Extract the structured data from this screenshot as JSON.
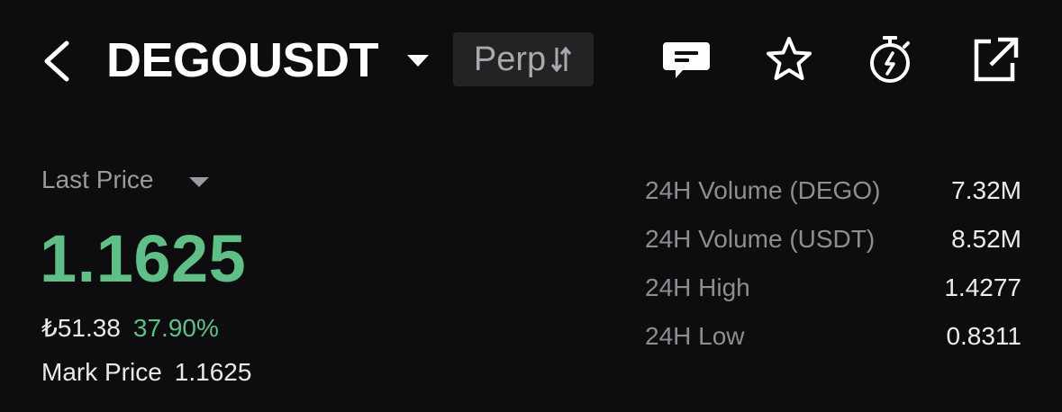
{
  "header": {
    "symbol": "DEGOUSDT",
    "contract_type": "Perp",
    "icons": {
      "back": "chevron-left-icon",
      "symbol_dropdown": "caret-down-icon",
      "switch": "swap-arrows-icon",
      "chat": "chat-icon",
      "favorite": "star-icon",
      "alert": "stopwatch-icon",
      "share": "share-icon"
    }
  },
  "price": {
    "label": "Last Price",
    "value": "1.1625",
    "fiat": "₺51.38",
    "change": "37.90%",
    "mark_label": "Mark Price",
    "mark_value": "1.1625"
  },
  "stats": [
    {
      "label": "24H Volume (DEGO)",
      "value": "7.32M"
    },
    {
      "label": "24H Volume (USDT)",
      "value": "8.52M"
    },
    {
      "label": "24H High",
      "value": "1.4277"
    },
    {
      "label": "24H Low",
      "value": "0.8311"
    }
  ],
  "colors": {
    "background": "#0d0d0f",
    "positive": "#5fbf87",
    "muted": "#9a9a9e",
    "badge_bg": "#232325"
  }
}
